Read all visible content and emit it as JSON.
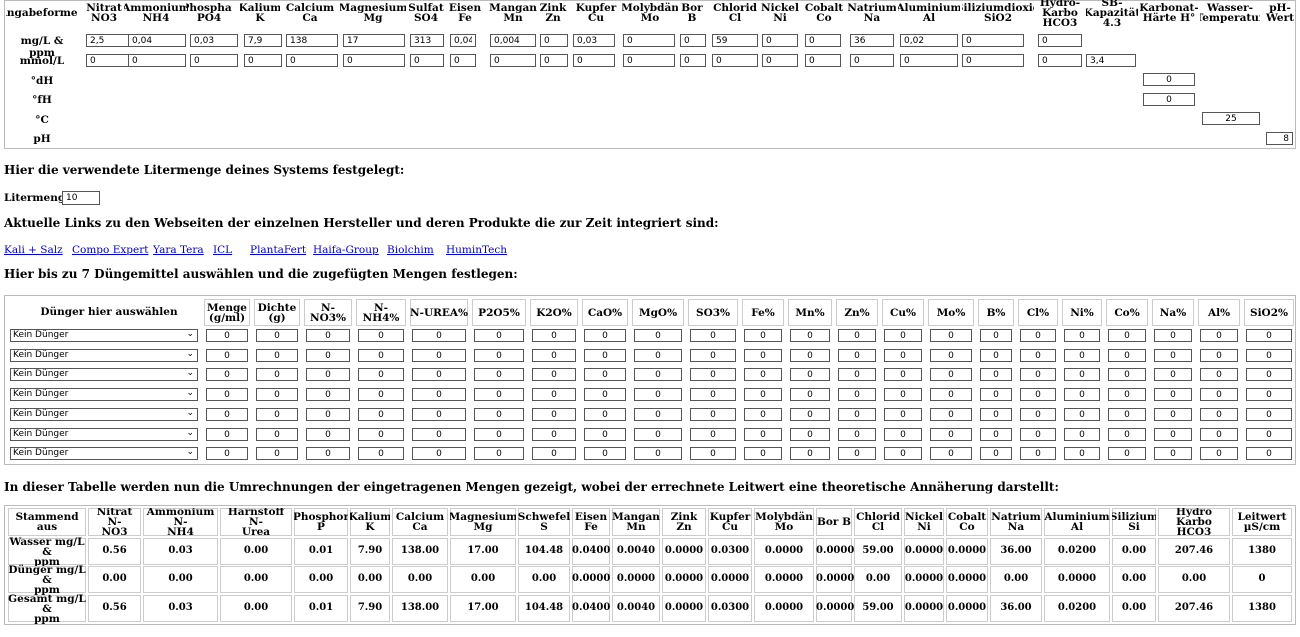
{
  "table1": {
    "corner": "Angabeformen",
    "columns": [
      {
        "l1": "Nitrat",
        "l2": "NO3"
      },
      {
        "l1": "Ammonium",
        "l2": "NH4"
      },
      {
        "l1": "Phosphat",
        "l2": "PO4"
      },
      {
        "l1": "Kalium",
        "l2": "K"
      },
      {
        "l1": "Calcium",
        "l2": "Ca"
      },
      {
        "l1": "Magnesium",
        "l2": "Mg"
      },
      {
        "l1": "Sulfat",
        "l2": "SO4"
      },
      {
        "l1": "Eisen",
        "l2": "Fe"
      },
      {
        "l1": "Mangan",
        "l2": "Mn"
      },
      {
        "l1": "Zink",
        "l2": "Zn"
      },
      {
        "l1": "Kupfer",
        "l2": "Cu"
      },
      {
        "l1": "Molybdän",
        "l2": "Mo"
      },
      {
        "l1": "Bor",
        "l2": "B"
      },
      {
        "l1": "Chlorid",
        "l2": "Cl"
      },
      {
        "l1": "Nickel",
        "l2": "Ni"
      },
      {
        "l1": "Cobalt",
        "l2": "Co"
      },
      {
        "l1": "Natrium",
        "l2": "Na"
      },
      {
        "l1": "Aluminium",
        "l2": "Al"
      },
      {
        "l1": "Siliziumdioxid",
        "l2": "SiO2"
      },
      {
        "l1": "Hydro-Karbo",
        "l2": "HCO3"
      },
      {
        "l1": "SB-Kapazität",
        "l2": "4.3"
      },
      {
        "l1": "Karbonat-",
        "l2": "Härte H°"
      },
      {
        "l1": "Wasser-",
        "l2": "Temperatur"
      },
      {
        "l1": "pH-",
        "l2": "Wert"
      }
    ],
    "row_labels": [
      "mg/L & ppm",
      "mmol/L",
      "°dH",
      "°fH",
      "°C",
      "pH"
    ],
    "mg_values": [
      "2,5",
      "0,04",
      "0,03",
      "7,9",
      "138",
      "17",
      "313",
      "0,04",
      "0,004",
      "0",
      "0,03",
      "0",
      "0",
      "59",
      "0",
      "0",
      "36",
      "0,02",
      "0",
      "0"
    ],
    "mmol_values": [
      "0",
      "0",
      "0",
      "0",
      "0",
      "0",
      "0",
      "0",
      "0",
      "0",
      "0",
      "0",
      "0",
      "0",
      "0",
      "0",
      "0",
      "0",
      "0",
      "0",
      "3,4"
    ],
    "dh_value": "0",
    "fh_value": "0",
    "temp_value": "25",
    "ph_value": "8"
  },
  "liter": {
    "heading": "Hier die verwendete Litermenge deines Systems festgelegt:",
    "label": "Litermenge:",
    "value": "10"
  },
  "links": {
    "heading": "Aktuelle Links zu den Webseiten der einzelnen Hersteller und deren Produkte die zur Zeit integriert sind:",
    "items": [
      "Kali + Salz",
      "Compo Expert",
      "Yara Tera",
      "ICL",
      "PlantaFert",
      "Haifa-Group",
      "Biolchim",
      "HuminTech"
    ]
  },
  "fert": {
    "heading": "Hier bis zu 7 Düngemittel auswählen und die zugefügten Mengen festlegen:",
    "select_header": "Dünger hier auswählen",
    "columns": [
      {
        "l1": "Menge",
        "l2": "(g/ml)"
      },
      {
        "l1": "Dichte (g)",
        "l2": ""
      },
      {
        "l1": "N-NO3%",
        "l2": ""
      },
      {
        "l1": "N-NH4%",
        "l2": ""
      },
      {
        "l1": "N-UREA%",
        "l2": ""
      },
      {
        "l1": "P2O5%",
        "l2": ""
      },
      {
        "l1": "K2O%",
        "l2": ""
      },
      {
        "l1": "CaO%",
        "l2": ""
      },
      {
        "l1": "MgO%",
        "l2": ""
      },
      {
        "l1": "SO3%",
        "l2": ""
      },
      {
        "l1": "Fe%",
        "l2": ""
      },
      {
        "l1": "Mn%",
        "l2": ""
      },
      {
        "l1": "Zn%",
        "l2": ""
      },
      {
        "l1": "Cu%",
        "l2": ""
      },
      {
        "l1": "Mo%",
        "l2": ""
      },
      {
        "l1": "B%",
        "l2": ""
      },
      {
        "l1": "Cl%",
        "l2": ""
      },
      {
        "l1": "Ni%",
        "l2": ""
      },
      {
        "l1": "Co%",
        "l2": ""
      },
      {
        "l1": "Na%",
        "l2": ""
      },
      {
        "l1": "Al%",
        "l2": ""
      },
      {
        "l1": "SiO2%",
        "l2": ""
      }
    ],
    "rows": [
      {
        "selected": "Kein Dünger",
        "values": [
          "0",
          "0",
          "0",
          "0",
          "0",
          "0",
          "0",
          "0",
          "0",
          "0",
          "0",
          "0",
          "0",
          "0",
          "0",
          "0",
          "0",
          "0",
          "0",
          "0",
          "0",
          "0"
        ]
      },
      {
        "selected": "Kein Dünger",
        "values": [
          "0",
          "0",
          "0",
          "0",
          "0",
          "0",
          "0",
          "0",
          "0",
          "0",
          "0",
          "0",
          "0",
          "0",
          "0",
          "0",
          "0",
          "0",
          "0",
          "0",
          "0",
          "0"
        ]
      },
      {
        "selected": "Kein Dünger",
        "values": [
          "0",
          "0",
          "0",
          "0",
          "0",
          "0",
          "0",
          "0",
          "0",
          "0",
          "0",
          "0",
          "0",
          "0",
          "0",
          "0",
          "0",
          "0",
          "0",
          "0",
          "0",
          "0"
        ]
      },
      {
        "selected": "Kein Dünger",
        "values": [
          "0",
          "0",
          "0",
          "0",
          "0",
          "0",
          "0",
          "0",
          "0",
          "0",
          "0",
          "0",
          "0",
          "0",
          "0",
          "0",
          "0",
          "0",
          "0",
          "0",
          "0",
          "0"
        ]
      },
      {
        "selected": "Kein Dünger",
        "values": [
          "0",
          "0",
          "0",
          "0",
          "0",
          "0",
          "0",
          "0",
          "0",
          "0",
          "0",
          "0",
          "0",
          "0",
          "0",
          "0",
          "0",
          "0",
          "0",
          "0",
          "0",
          "0"
        ]
      },
      {
        "selected": "Kein Dünger",
        "values": [
          "0",
          "0",
          "0",
          "0",
          "0",
          "0",
          "0",
          "0",
          "0",
          "0",
          "0",
          "0",
          "0",
          "0",
          "0",
          "0",
          "0",
          "0",
          "0",
          "0",
          "0",
          "0"
        ]
      },
      {
        "selected": "Kein Dünger",
        "values": [
          "0",
          "0",
          "0",
          "0",
          "0",
          "0",
          "0",
          "0",
          "0",
          "0",
          "0",
          "0",
          "0",
          "0",
          "0",
          "0",
          "0",
          "0",
          "0",
          "0",
          "0",
          "0"
        ]
      }
    ]
  },
  "results": {
    "heading": "In dieser Tabelle werden nun die Umrechnungen der eingetragenen Mengen gezeigt, wobei der errechnete Leitwert eine theoretische Annäherung darstellt:",
    "corner": "Stammend aus",
    "columns": [
      {
        "l1": "Nitrat N-",
        "l2": "NO3"
      },
      {
        "l1": "Ammonium N-",
        "l2": "NH4"
      },
      {
        "l1": "Harnstoff N-",
        "l2": "Urea"
      },
      {
        "l1": "Phosphor",
        "l2": "P"
      },
      {
        "l1": "Kalium",
        "l2": "K"
      },
      {
        "l1": "Calcium",
        "l2": "Ca"
      },
      {
        "l1": "Magnesium",
        "l2": "Mg"
      },
      {
        "l1": "Schwefel",
        "l2": "S"
      },
      {
        "l1": "Eisen",
        "l2": "Fe"
      },
      {
        "l1": "Mangan",
        "l2": "Mn"
      },
      {
        "l1": "Zink",
        "l2": "Zn"
      },
      {
        "l1": "Kupfer",
        "l2": "Cu"
      },
      {
        "l1": "Molybdän",
        "l2": "Mo"
      },
      {
        "l1": "Bor B",
        "l2": ""
      },
      {
        "l1": "Chlorid",
        "l2": "Cl"
      },
      {
        "l1": "Nickel",
        "l2": "Ni"
      },
      {
        "l1": "Cobalt",
        "l2": "Co"
      },
      {
        "l1": "Natrium",
        "l2": "Na"
      },
      {
        "l1": "Aluminium",
        "l2": "Al"
      },
      {
        "l1": "Silizium",
        "l2": "Si"
      },
      {
        "l1": "Hydro Karbo",
        "l2": "HCO3"
      },
      {
        "l1": "Leitwert",
        "l2": "µS/cm"
      }
    ],
    "rows": [
      {
        "l1": "Wasser mg/L &",
        "l2": "ppm",
        "values": [
          "0.56",
          "0.03",
          "0.00",
          "0.01",
          "7.90",
          "138.00",
          "17.00",
          "104.48",
          "0.0400",
          "0.0040",
          "0.0000",
          "0.0300",
          "0.0000",
          "0.0000",
          "59.00",
          "0.0000",
          "0.0000",
          "36.00",
          "0.0200",
          "0.00",
          "207.46",
          "1380"
        ]
      },
      {
        "l1": "Dünger mg/L &",
        "l2": "ppm",
        "values": [
          "0.00",
          "0.00",
          "0.00",
          "0.00",
          "0.00",
          "0.00",
          "0.00",
          "0.00",
          "0.0000",
          "0.0000",
          "0.0000",
          "0.0000",
          "0.0000",
          "0.0000",
          "0.00",
          "0.0000",
          "0.0000",
          "0.00",
          "0.0000",
          "0.00",
          "0.00",
          "0"
        ]
      },
      {
        "l1": "Gesamt mg/L &",
        "l2": "ppm",
        "values": [
          "0.56",
          "0.03",
          "0.00",
          "0.01",
          "7.90",
          "138.00",
          "17.00",
          "104.48",
          "0.0400",
          "0.0040",
          "0.0000",
          "0.0300",
          "0.0000",
          "0.0000",
          "59.00",
          "0.0000",
          "0.0000",
          "36.00",
          "0.0200",
          "0.00",
          "207.46",
          "1380"
        ]
      }
    ]
  }
}
